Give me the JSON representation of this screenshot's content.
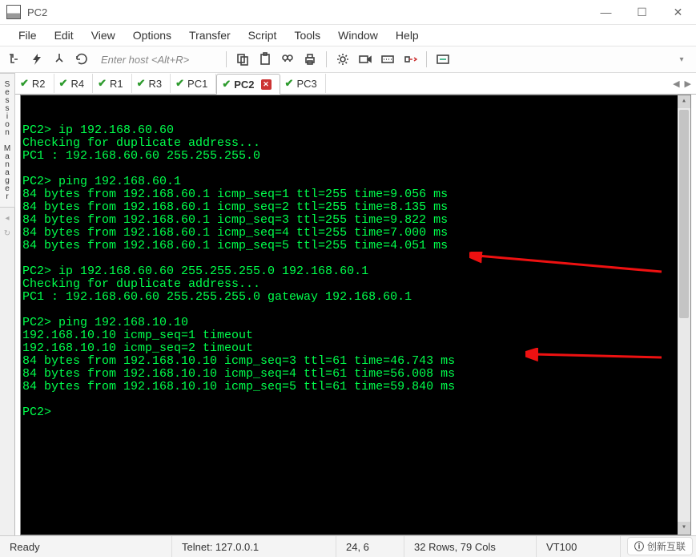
{
  "window": {
    "title": "PC2"
  },
  "menu": {
    "items": [
      "File",
      "Edit",
      "View",
      "Options",
      "Transfer",
      "Script",
      "Tools",
      "Window",
      "Help"
    ]
  },
  "toolbar": {
    "host_placeholder": "Enter host <Alt+R>"
  },
  "sidebar": {
    "label": "Session Manager"
  },
  "tabs": {
    "items": [
      {
        "label": "R2",
        "active": false
      },
      {
        "label": "R4",
        "active": false
      },
      {
        "label": "R1",
        "active": false
      },
      {
        "label": "R3",
        "active": false
      },
      {
        "label": "PC1",
        "active": false
      },
      {
        "label": "PC2",
        "active": true
      },
      {
        "label": "PC3",
        "active": false
      }
    ]
  },
  "terminal": {
    "lines": [
      "PC2> ip 192.168.60.60",
      "Checking for duplicate address...",
      "PC1 : 192.168.60.60 255.255.255.0",
      "",
      "PC2> ping 192.168.60.1",
      "84 bytes from 192.168.60.1 icmp_seq=1 ttl=255 time=9.056 ms",
      "84 bytes from 192.168.60.1 icmp_seq=2 ttl=255 time=8.135 ms",
      "84 bytes from 192.168.60.1 icmp_seq=3 ttl=255 time=9.822 ms",
      "84 bytes from 192.168.60.1 icmp_seq=4 ttl=255 time=7.000 ms",
      "84 bytes from 192.168.60.1 icmp_seq=5 ttl=255 time=4.051 ms",
      "",
      "PC2> ip 192.168.60.60 255.255.255.0 192.168.60.1",
      "Checking for duplicate address...",
      "PC1 : 192.168.60.60 255.255.255.0 gateway 192.168.60.1",
      "",
      "PC2> ping 192.168.10.10",
      "192.168.10.10 icmp_seq=1 timeout",
      "192.168.10.10 icmp_seq=2 timeout",
      "84 bytes from 192.168.10.10 icmp_seq=3 ttl=61 time=46.743 ms",
      "84 bytes from 192.168.10.10 icmp_seq=4 ttl=61 time=56.008 ms",
      "84 bytes from 192.168.10.10 icmp_seq=5 ttl=61 time=59.840 ms",
      "",
      "PC2>"
    ]
  },
  "status": {
    "ready": "Ready",
    "connection": "Telnet: 127.0.0.1",
    "cursor": "24,  6",
    "size": "32 Rows, 79 Cols",
    "emulation": "VT100"
  },
  "watermark": {
    "text": "创新互联"
  }
}
